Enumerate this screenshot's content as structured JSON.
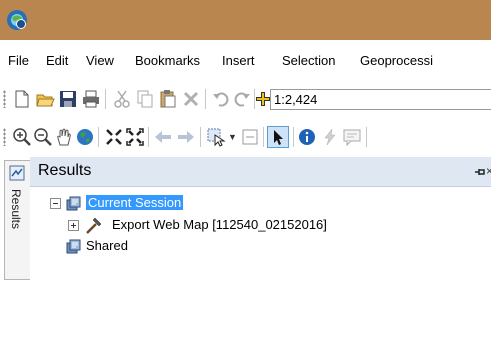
{
  "menu": {
    "items": [
      "File",
      "Edit",
      "View",
      "Bookmarks",
      "Insert",
      "Selection",
      "Geoprocessi"
    ]
  },
  "toolbar": {
    "scale_value": "1:2,424"
  },
  "side_tab": {
    "label": "Results"
  },
  "results_panel": {
    "title": "Results",
    "close_glyph": "×",
    "tree": {
      "current_session": "Current Session",
      "export_job": "Export Web Map [112540_02152016]",
      "shared": "Shared"
    }
  },
  "colors": {
    "titlebar": "#b9864f",
    "panel_header": "#dfe7f2",
    "selection": "#3399ff"
  }
}
